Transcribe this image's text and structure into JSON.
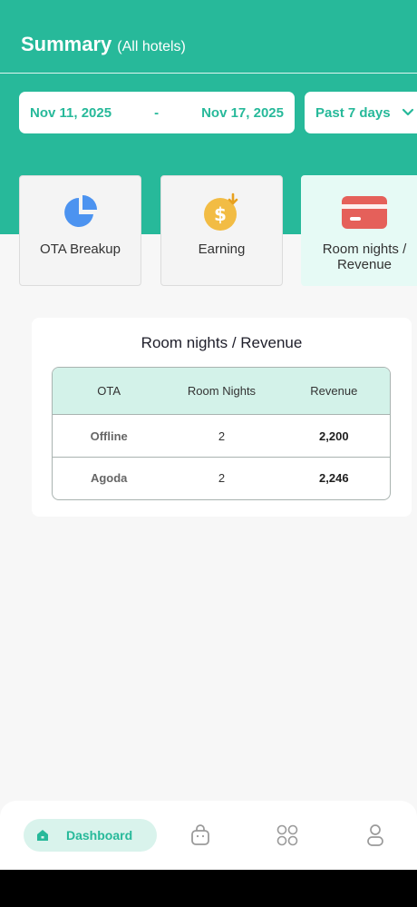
{
  "header": {
    "title": "Summary",
    "subtitle": "(All hotels)",
    "bg_color": "#27b99a"
  },
  "date_range": {
    "start": "Nov 11, 2025",
    "separator": "-",
    "end": "Nov 17, 2025"
  },
  "period": {
    "selected": "Past 7 days",
    "icon": "chevron-down-icon"
  },
  "cards": [
    {
      "label": "OTA Breakup",
      "icon": "pie-chart-icon",
      "color": "#4c93f0"
    },
    {
      "label": "Earning",
      "icon": "dollar-coin-icon",
      "color": "#f2bc44"
    },
    {
      "label": "Room nights / Revenue",
      "icon": "credit-card-icon",
      "color": "#e5605a",
      "active": true
    }
  ],
  "panel": {
    "title": "Room nights / Revenue",
    "columns": [
      "OTA",
      "Room Nights",
      "Revenue"
    ],
    "rows": [
      {
        "ota": "Offline",
        "room_nights": "2",
        "revenue": "2,200"
      },
      {
        "ota": "Agoda",
        "room_nights": "2",
        "revenue": "2,246"
      }
    ]
  },
  "bottom_nav": {
    "items": [
      {
        "label": "Dashboard",
        "icon": "home-icon",
        "active": true
      },
      {
        "label": "",
        "icon": "shopping-bag-icon"
      },
      {
        "label": "",
        "icon": "apps-grid-icon"
      },
      {
        "label": "",
        "icon": "profile-icon"
      }
    ]
  }
}
